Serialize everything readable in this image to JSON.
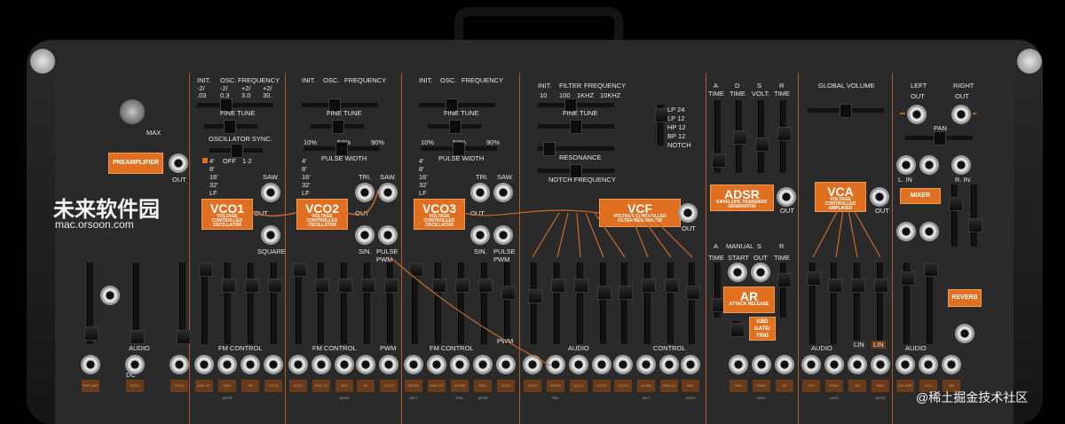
{
  "top": {
    "init_label": "INIT.",
    "osc_label": "OSC.",
    "freq_label": "FREQUENCY",
    "minus2_label": "-2/",
    "minus2b": "-2/",
    "plus2": "+2/",
    "l_03": ".03",
    "l_3": "0.3",
    "l_30a": "3.0",
    "l_30b": "30.",
    "fine_tune": "FINE TUNE",
    "oscillator_sync": "OSCILLATOR SYNC.",
    "pulse_width": "PULSE WIDTH",
    "pct10": "10%",
    "pct50": "50%",
    "pct90": "90%",
    "off": "OFF",
    "one_two": "1·2",
    "max": "MAX",
    "out": "OUT",
    "saw": "SAW.",
    "tri": "TRI.",
    "sin": "SIN.",
    "square": "SQUARE",
    "pulse_pwm": "PULSE PWM",
    "ft_4": "4'",
    "ft_8": "8'",
    "ft_16": "16'",
    "ft_32": "32'",
    "ft_lf": "LF"
  },
  "modules": {
    "preamplifier": "PREAMPLIFIER",
    "vco1": "VCO1",
    "vco2": "VCO2",
    "vco3": "VCO3",
    "vco_sub": "VOLTAGE CONTROLLED OSCILLATOR",
    "vcf": "VCF",
    "vcf_sub": "VOLTAGE CONTROLLED FILTER/RESONATOR",
    "adsr": "ADSR",
    "adsr_sub": "ENVELOPE TRANSIENT GENERATOR",
    "vca": "VCA",
    "vca_sub": "VOLTAGE CONTROLLED AMPLIFIER",
    "ar": "AR",
    "ar_sub": "ATTACK RELEASE",
    "kbd_gate": "KBD GATE/ TRIG",
    "mixer": "MIXER",
    "reverb": "REVERB"
  },
  "filter": {
    "init": "INIT.",
    "filter": "FILTER",
    "frequency": "FREQUENCY",
    "f10": "10",
    "f100": "100",
    "f1k": "1KHZ",
    "f10k": "10KHZ",
    "fine_tune": "FINE TUNE",
    "resonance": "RESONANCE",
    "notch_frequency": "NOTCH FREQUENCY",
    "modes": [
      "LP 24",
      "LP 12",
      "HP 12",
      "BP 12",
      "NOTCH"
    ]
  },
  "env": {
    "a": "A",
    "d": "D",
    "s": "S",
    "r": "R",
    "time": "TIME",
    "volt": "VOLT.",
    "manual": "MANUAL",
    "start": "START",
    "out": "OUT"
  },
  "global": {
    "global_volume": "GLOBAL VOLUME",
    "left": "LEFT",
    "right": "RIGHT",
    "out": "OUT",
    "pan": "PAN",
    "l_in": "L. IN",
    "r_in": "R. IN",
    "lin": "LIN"
  },
  "bottom": {
    "audio": "AUDIO",
    "dc": "DC",
    "fm_control": "FM CONTROL",
    "pwm": "PWM",
    "control": "CONTROL"
  },
  "bottom_buttons": [
    "PRE AMP",
    "VCO1",
    "VCO2",
    "KBD CV",
    "ENV ADSR",
    "AR",
    "VCO3",
    "VCO1",
    "KBD CV",
    "ENV ADSR",
    "AR",
    "VCO2",
    "NOISE WHT",
    "KBD CV",
    "NOISE PNK",
    "ENV ADSR",
    "VCO3",
    "VCO2",
    "NOISE PNK",
    "VCO1",
    "VCO2",
    "VCO3",
    "NOISE WHT",
    "KBD CV",
    "ENV ADSR",
    "S&H",
    "RING MOD",
    "AR",
    "VCF",
    "RING MOD",
    "AR",
    "ENV ADSR",
    "LIN AMP",
    "VCO",
    "AR"
  ],
  "watermark": {
    "main": "未来软件园",
    "sub": "mac.orsoon.com"
  },
  "credit": "@稀土掘金技术社区",
  "colors": {
    "accent": "#e0701f",
    "panel": "#2a2a2a",
    "case": "#1c1c1c"
  },
  "icons": [
    "vco-wave-icon",
    "jack-icon",
    "knob-icon",
    "slider-icon"
  ]
}
